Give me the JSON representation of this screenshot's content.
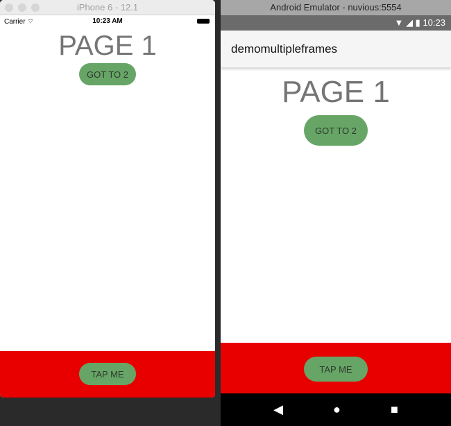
{
  "ios": {
    "window_title": "iPhone 6 - 12.1",
    "carrier": "Carrier",
    "time": "10:23 AM",
    "page_title": "PAGE 1",
    "goto_label": "GOT TO 2",
    "tap_label": "TAP ME"
  },
  "android": {
    "window_title": "Android Emulator - nuvious:5554",
    "time": "10:23",
    "app_title": "demomultipleframes",
    "page_title": "PAGE 1",
    "goto_label": "GOT TO 2",
    "tap_label": "TAP ME",
    "nav": {
      "back": "◀",
      "home": "●",
      "recents": "■"
    }
  },
  "colors": {
    "button": "#67a566",
    "footer": "#e80000"
  }
}
